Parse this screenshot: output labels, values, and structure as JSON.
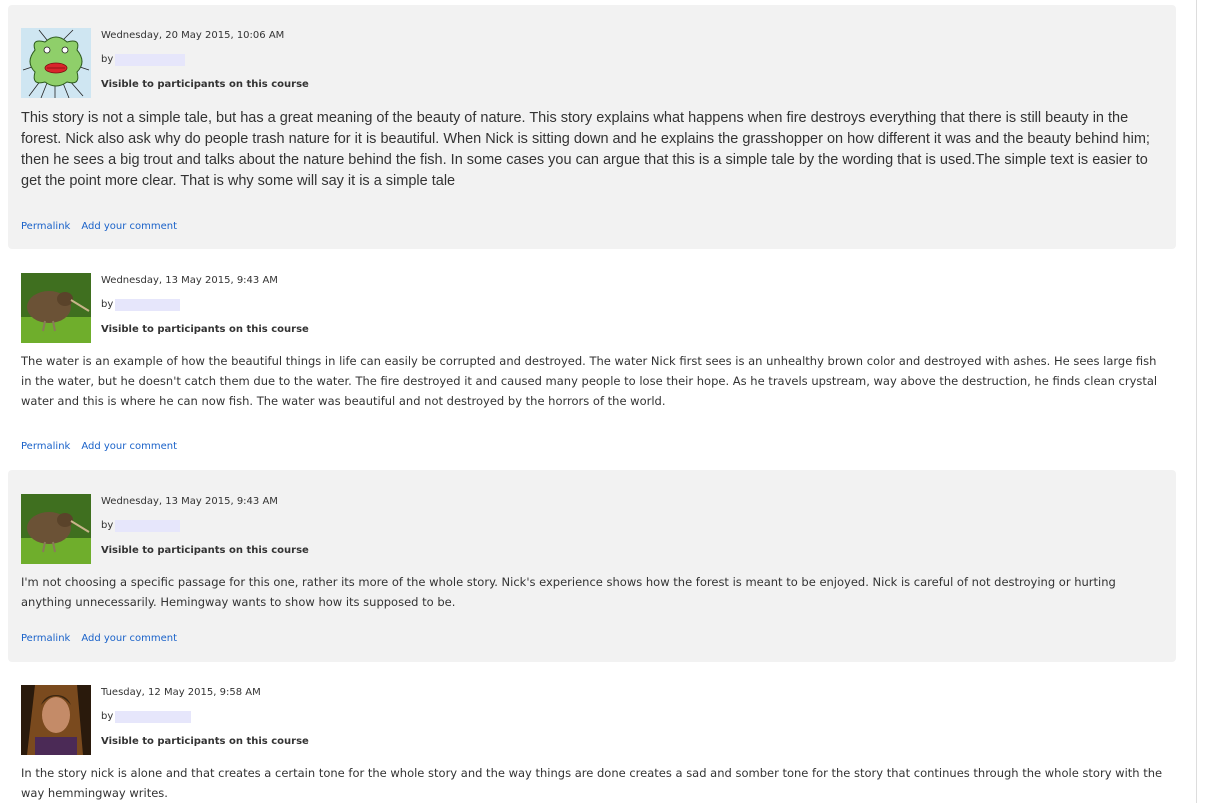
{
  "posts": [
    {
      "date": "Wednesday, 20 May 2015, 10:06 AM",
      "by": "by",
      "visibility": "Visible to participants on this course",
      "avatar": "bug-cartoon-avatar",
      "text": "This story is not a simple tale, but has a great meaning of the beauty of nature. This story explains what happens when fire destroys everything that there is still beauty in the forest. Nick also ask why do people trash nature for it is beautiful. When Nick is sitting down and he explains the grasshopper on how different it was and the beauty behind him; then he sees a big trout and talks about the nature behind the fish. In some cases you can argue that this is a simple tale by the wording that is used.The simple text is easier to get the point more clear. That is why some will say it is a simple tale",
      "permalink": "Permalink",
      "comment": "Add your comment"
    },
    {
      "date": "Wednesday, 13 May 2015, 9:43 AM",
      "by": "by",
      "visibility": "Visible to participants on this course",
      "avatar": "kiwi-bird-avatar",
      "text": "The water is an example of how the beautiful things in life can easily be corrupted and destroyed. The water Nick first sees is an unhealthy brown color and destroyed with ashes. He sees large fish in the water, but he doesn't catch them due to the water. The fire destroyed it and caused many people to lose their hope. As he travels upstream, way above the destruction, he finds clean crystal water and this is where he can now fish. The water was beautiful and not destroyed by the horrors of the world.",
      "permalink": "Permalink",
      "comment": "Add your comment"
    },
    {
      "date": "Wednesday, 13 May 2015, 9:43 AM",
      "by": "by",
      "visibility": "Visible to participants on this course",
      "avatar": "kiwi-bird-avatar",
      "text": "I'm not choosing a specific passage for this one, rather its more of the whole story. Nick's experience shows how the forest is meant to be enjoyed. Nick is careful of not destroying or hurting anything unnecessarily. Hemingway wants to show how its supposed to be.",
      "permalink": "Permalink",
      "comment": "Add your comment"
    },
    {
      "date": "Tuesday, 12 May 2015, 9:58 AM",
      "by": "by",
      "visibility": "Visible to participants on this course",
      "avatar": "person-photo-avatar",
      "text": "In the story nick is alone and that creates a certain tone for the whole story and the way things are done creates a sad and somber tone for the story that continues through the whole story with the way hemmingway writes."
    }
  ],
  "colors": {
    "link": "#1a62c9",
    "shaded": "#f2f2f2",
    "text": "#333333",
    "redacted": "#e6e6fb"
  }
}
